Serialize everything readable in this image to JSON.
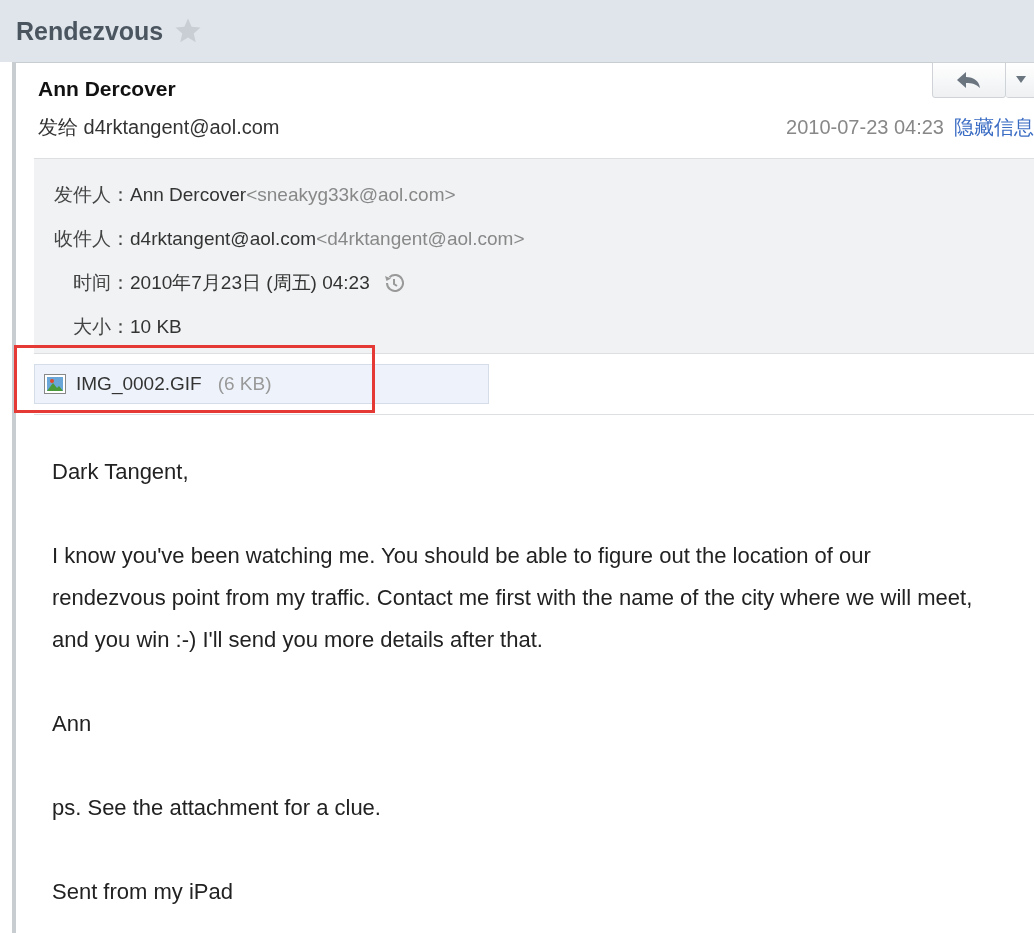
{
  "title": "Rendezvous",
  "starred": false,
  "message": {
    "sender_name": "Ann Dercover",
    "to_line": {
      "label": "发给",
      "address": "d4rktangent@aol.com"
    },
    "date": "2010-07-23 04:23",
    "hide_details_link": "隐藏信息",
    "details": [
      {
        "kind": "contact",
        "label": "发件人：",
        "name": "Ann Dercover",
        "address": "<sneakyg33k@aol.com>"
      },
      {
        "kind": "contact",
        "label": "收件人：",
        "name": "d4rktangent@aol.com",
        "address": "<d4rktangent@aol.com>"
      },
      {
        "kind": "time",
        "label": "时间：",
        "value": "2010年7月23日 (周五) 04:23"
      },
      {
        "kind": "plain",
        "label": "大小：",
        "value": "10 KB"
      }
    ],
    "attachments": [
      {
        "name": "IMG_0002.GIF",
        "size": "(6 KB)",
        "highlighted": true
      }
    ],
    "body": [
      "Dark Tangent,",
      "I know you've been watching me. You should be able to figure out the location of our rendezvous point from my traffic. Contact me first with the name of the city where we will meet, and you win :-) I'll send you more details after that.",
      "Ann",
      "ps. See the attachment for a clue.",
      "Sent from my iPad"
    ]
  }
}
